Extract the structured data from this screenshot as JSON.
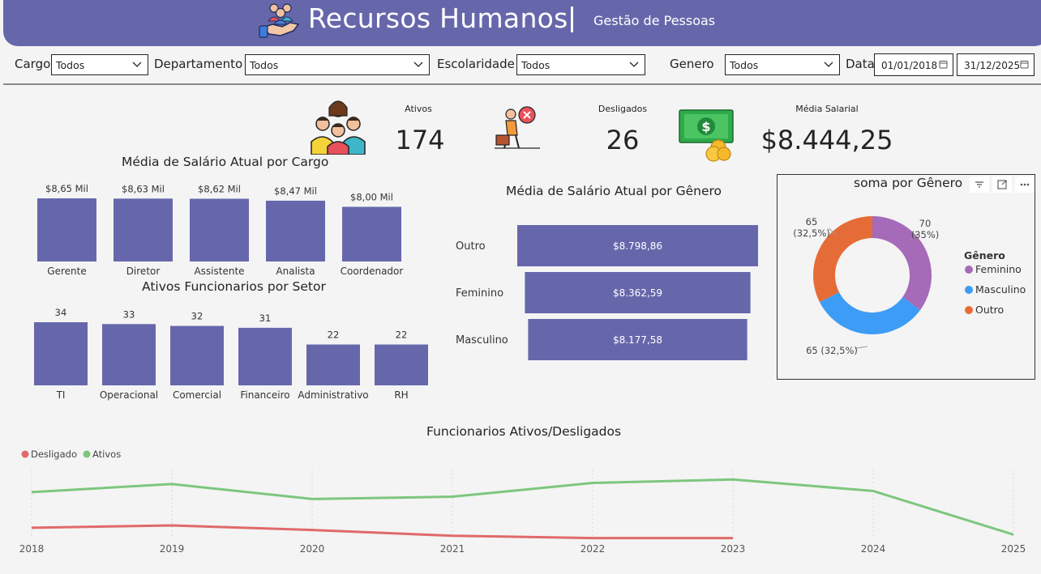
{
  "header": {
    "title": "Recursos Humanos",
    "subtitle": "Gestão de Pessoas",
    "icon": "people-in-hand-icon",
    "color": "#6667ab"
  },
  "filters": {
    "cargo": {
      "label": "Cargo",
      "value": "Todos"
    },
    "departamento": {
      "label": "Departamento",
      "value": "Todos"
    },
    "escolaridade": {
      "label": "Escolaridade",
      "value": "Todos"
    },
    "genero": {
      "label": "Genero",
      "value": "Todos"
    },
    "data": {
      "label": "Data",
      "start": "01/01/2018",
      "end": "31/12/2025"
    }
  },
  "kpis": {
    "ativos": {
      "label": "Ativos",
      "value": "174",
      "icon": "team-icon"
    },
    "desligados": {
      "label": "Desligados",
      "value": "26",
      "icon": "dismissed-worker-icon"
    },
    "media_salarial": {
      "label": "Média Salarial",
      "value": "$8.444,25",
      "icon": "money-icon"
    }
  },
  "chart_data": [
    {
      "id": "salario_cargo",
      "type": "bar",
      "title": "Média de Salário Atual por Cargo",
      "categories": [
        "Gerente",
        "Diretor",
        "Assistente",
        "Analista",
        "Coordenador"
      ],
      "values": [
        8650,
        8630,
        8620,
        8470,
        8000
      ],
      "labels": [
        "$8,65 Mil",
        "$8,63 Mil",
        "$8,62 Mil",
        "$8,47 Mil",
        "$8,00 Mil"
      ],
      "color": "#6667ab"
    },
    {
      "id": "ativos_setor",
      "type": "bar",
      "title": "Ativos Funcionarios por Setor",
      "categories": [
        "TI",
        "Operacional",
        "Comercial",
        "Financeiro",
        "Administrativo",
        "RH"
      ],
      "values": [
        34,
        33,
        32,
        31,
        22,
        22
      ],
      "labels": [
        "34",
        "33",
        "32",
        "31",
        "22",
        "22"
      ],
      "color": "#6667ab"
    },
    {
      "id": "salario_genero",
      "type": "bar",
      "orientation": "horizontal",
      "title": "Média de Salário Atual por Gênero",
      "categories": [
        "Outro",
        "Feminino",
        "Masculino"
      ],
      "values": [
        8798.86,
        8362.59,
        8177.58
      ],
      "labels": [
        "$8.798,86",
        "$8.362,59",
        "$8.177,58"
      ],
      "color": "#6667ab"
    },
    {
      "id": "soma_genero",
      "type": "pie",
      "variant": "donut",
      "title": "soma por Gênero",
      "legend_title": "Gênero",
      "legend_position": "right",
      "categories": [
        "Feminino",
        "Masculino",
        "Outro"
      ],
      "values": [
        70,
        65,
        65
      ],
      "labels": [
        "70\n(35%)",
        "65 (32,5%)",
        "65\n(32,5%)"
      ],
      "colors": [
        "#a66bb8",
        "#3d9cf5",
        "#e66c37"
      ]
    },
    {
      "id": "ativos_desligados",
      "type": "line",
      "title": "Funcionarios Ativos/Desligados",
      "legend_position": "top-left",
      "x": [
        "2018",
        "2019",
        "2020",
        "2021",
        "2022",
        "2023",
        "2024",
        "2025"
      ],
      "series": [
        {
          "name": "Desligado",
          "color": "#e06a6a",
          "values": [
            10,
            12,
            8,
            3,
            1,
            1,
            null,
            null
          ]
        },
        {
          "name": "Ativos",
          "color": "#7dc67e",
          "values": [
            41,
            48,
            35,
            37,
            49,
            52,
            42,
            4
          ]
        }
      ]
    }
  ]
}
